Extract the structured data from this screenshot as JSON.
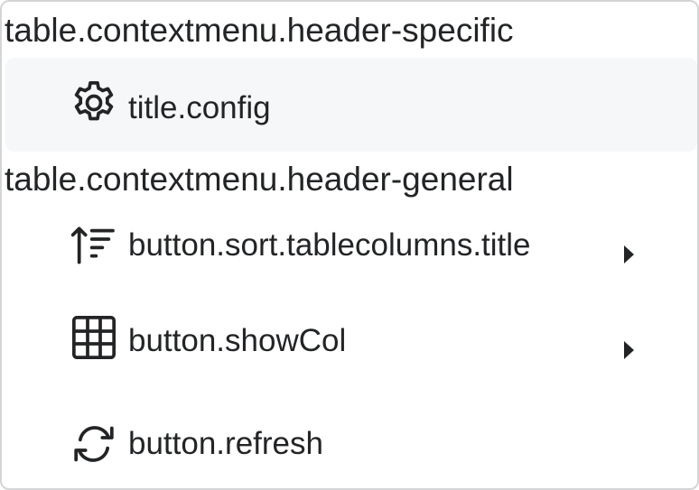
{
  "menu": {
    "header_specific": "table.contextmenu.header-specific",
    "header_general": "table.contextmenu.header-general",
    "items": [
      {
        "label": "title.config",
        "icon": "gear-icon",
        "has_submenu": false,
        "highlighted": true
      },
      {
        "label": "button.sort.tablecolumns.title",
        "icon": "sort-ascending-icon",
        "has_submenu": true,
        "highlighted": false
      },
      {
        "label": "button.showCol",
        "icon": "table-grid-icon",
        "has_submenu": true,
        "highlighted": false
      },
      {
        "label": "button.refresh",
        "icon": "refresh-icon",
        "has_submenu": false,
        "highlighted": false
      }
    ]
  },
  "colors": {
    "text": "#222426",
    "highlight_background": "#f6f7f8",
    "border": "#d4d5d7"
  }
}
